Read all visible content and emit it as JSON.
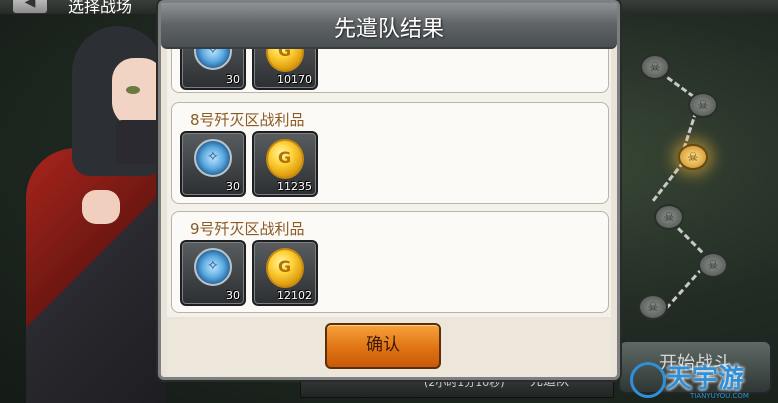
{
  "scene": {
    "title": "选择战场",
    "back_icon": "left-arrow-icon",
    "battle_label": "开始战斗",
    "bottom_status": "(2小时1分10秒)",
    "bottom_button": "先遣队"
  },
  "dialog": {
    "title": "先遣队结果",
    "confirm_label": "确认",
    "cards": [
      {
        "title": "",
        "items": [
          {
            "icon": "compass-icon",
            "qty": "30"
          },
          {
            "icon": "gold-coin-icon",
            "qty": "10170"
          }
        ]
      },
      {
        "title": "8号歼灭区战利品",
        "items": [
          {
            "icon": "compass-icon",
            "qty": "30"
          },
          {
            "icon": "gold-coin-icon",
            "qty": "11235"
          }
        ]
      },
      {
        "title": "9号歼灭区战利品",
        "items": [
          {
            "icon": "compass-icon",
            "qty": "30"
          },
          {
            "icon": "gold-coin-icon",
            "qty": "12102"
          }
        ]
      }
    ]
  },
  "watermark": {
    "text": "天宇游",
    "url": "TIANYUYOU.COM"
  },
  "colors": {
    "card_title": "#8a5a22",
    "confirm_button": "#e07414",
    "dialog_header": "#5e6366"
  }
}
